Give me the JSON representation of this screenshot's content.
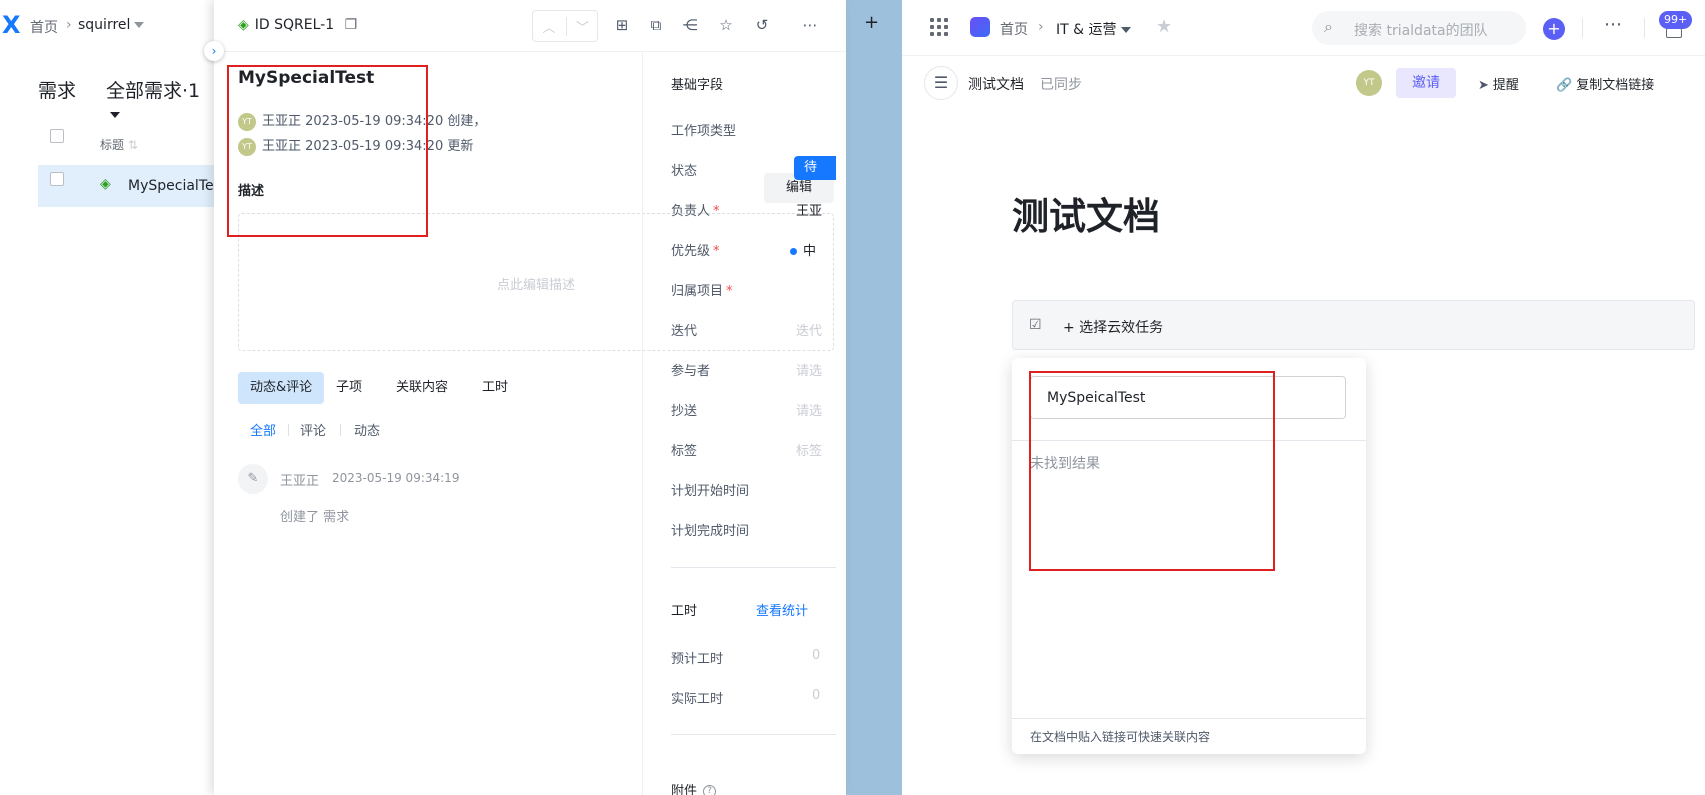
{
  "left_app": {
    "breadcrumb_home": "首页",
    "breadcrumb_project": "squirrel",
    "page_title": "需求",
    "filter_label": "全部需求·1",
    "column_title": "标题",
    "row_title": "MySpecialTest"
  },
  "detail": {
    "id_label": "ID SQREL-1",
    "title": "MySpecialTest",
    "created_user": "王亚正",
    "created_time": "2023-05-19 09:34:20",
    "created_suffix": "创建，",
    "updated_user": "王亚正",
    "updated_time": "2023-05-19 09:34:20",
    "updated_suffix": "更新",
    "avatar_initials": "YT",
    "description_label": "描述",
    "edit_button": "编辑",
    "description_placeholder": "点此编辑描述",
    "tabs": [
      "动态&评论",
      "子项",
      "关联内容",
      "工时"
    ],
    "subtabs": [
      "全部",
      "评论",
      "动态"
    ],
    "activity": {
      "user": "王亚正",
      "time": "2023-05-19 09:34:19",
      "text": "创建了 需求"
    },
    "fields": {
      "section_basic": "基础字段",
      "work_item_type": "工作项类型",
      "status": "状态",
      "status_value": "待",
      "assignee": "负责人",
      "assignee_value": "王亚",
      "priority": "优先级",
      "priority_value": "中",
      "project": "归属项目",
      "iteration": "迭代",
      "iteration_value": "迭代",
      "participants": "参与者",
      "participants_value": "请选",
      "cc": "抄送",
      "cc_value": "请选",
      "tags": "标签",
      "tags_value": "标签",
      "plan_start": "计划开始时间",
      "plan_end": "计划完成时间",
      "section_worktime": "工时",
      "view_stats": "查看统计",
      "estimated": "预计工时",
      "estimated_value": "0",
      "actual": "实际工时",
      "actual_value": "0",
      "attachments": "附件",
      "required_mark": "*"
    }
  },
  "doc_app": {
    "breadcrumb_home": "首页",
    "breadcrumb_team": "IT & 运营",
    "search_placeholder": "搜索 trialdata的团队",
    "notification_badge": "99+",
    "doc_name": "测试文档",
    "sync_status": "已同步",
    "avatar_initials": "YT",
    "invite_button": "邀请",
    "remind_button": "提醒",
    "copy_link_button": "复制文档链接",
    "doc_heading": "测试文档",
    "task_selector": "+ 选择云效任务",
    "search_input_value": "MySpeicalTest",
    "no_result": "未找到结果",
    "popup_footer": "在文档中贴入链接可快速关联内容"
  },
  "colors": {
    "accent_blue": "#1677ff",
    "brand_purple": "#5b5ff5",
    "highlight_red": "#e02020"
  }
}
